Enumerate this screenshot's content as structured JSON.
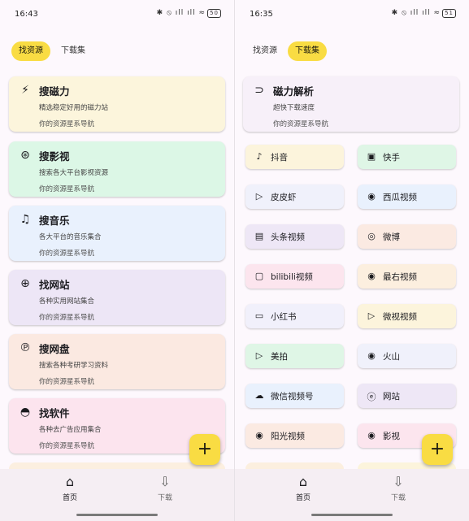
{
  "left_screen": {
    "status": {
      "time": "16:43",
      "icons": "✱ ⦸ ıll ıll ≈",
      "battery": "50"
    },
    "tabs": [
      {
        "label": "找资源",
        "active": true
      },
      {
        "label": "下载集",
        "active": false
      }
    ],
    "cards": [
      {
        "icon": "bolt-icon",
        "glyph": "⚡",
        "title": "搜磁力",
        "desc": "精选稳定好用的磁力站",
        "footer": "你的资源星系导航",
        "color": "#fcf5dc"
      },
      {
        "icon": "film-reel-icon",
        "glyph": "⊛",
        "title": "搜影视",
        "desc": "搜索各大平台影视资源",
        "footer": "你的资源星系导航",
        "color": "#dcf7e6"
      },
      {
        "icon": "music-note-icon",
        "glyph": "♫",
        "title": "搜音乐",
        "desc": "各大平台的音乐集合",
        "footer": "你的资源星系导航",
        "color": "#e9f1fd"
      },
      {
        "icon": "globe-icon",
        "glyph": "⊕",
        "title": "找网站",
        "desc": "各种实用网站集合",
        "footer": "你的资源星系导航",
        "color": "#ede6f6"
      },
      {
        "icon": "pinterest-icon",
        "glyph": "℗",
        "title": "搜网盘",
        "desc": "搜索各种考研学习资料",
        "footer": "你的资源星系导航",
        "color": "#fbe9e1"
      },
      {
        "icon": "android-icon",
        "glyph": "◓",
        "title": "找软件",
        "desc": "各种去广告应用集合",
        "footer": "你的资源星系导航",
        "color": "#fce4ee"
      }
    ],
    "fab_label": "+",
    "nav": [
      {
        "icon": "home-icon",
        "glyph": "⌂",
        "label": "首页",
        "active": true
      },
      {
        "icon": "download-icon",
        "glyph": "⇩",
        "label": "下载",
        "active": false
      }
    ]
  },
  "right_screen": {
    "status": {
      "time": "16:35",
      "icons": "✱ ⦸ ıll ıll ≈",
      "battery": "51"
    },
    "tabs": [
      {
        "label": "找资源",
        "active": false
      },
      {
        "label": "下载集",
        "active": true
      }
    ],
    "magnet_card": {
      "icon": "magnet-icon",
      "glyph": "⊃",
      "title": "磁力解析",
      "desc": "超快下载速度",
      "footer": "你的资源星系导航",
      "color": "#f7f0f9"
    },
    "grid": [
      {
        "icon": "tiktok-icon",
        "glyph": "♪",
        "label": "抖音",
        "color": "#fcf4dc"
      },
      {
        "icon": "kuaishou-icon",
        "glyph": "▣",
        "label": "快手",
        "color": "#dff6e6"
      },
      {
        "icon": "video-play-icon",
        "glyph": "▷",
        "label": "皮皮虾",
        "color": "#f0f1fb"
      },
      {
        "icon": "play-circle-icon",
        "glyph": "◉",
        "label": "西瓜视频",
        "color": "#e9f1fd"
      },
      {
        "icon": "news-icon",
        "glyph": "▤",
        "label": "头条视频",
        "color": "#eee7f6"
      },
      {
        "icon": "weibo-icon",
        "glyph": "◎",
        "label": "微博",
        "color": "#fbeae2"
      },
      {
        "icon": "bilibili-icon",
        "glyph": "▢",
        "label": "bilibili视频",
        "color": "#fce5ee"
      },
      {
        "icon": "play-circle-icon",
        "glyph": "◉",
        "label": "最右视频",
        "color": "#fcefdf"
      },
      {
        "icon": "video-box-icon",
        "glyph": "▭",
        "label": "小红书",
        "color": "#f1f0fb"
      },
      {
        "icon": "video-play-icon",
        "glyph": "▷",
        "label": "微视视频",
        "color": "#fcf4dc"
      },
      {
        "icon": "video-play-icon",
        "glyph": "▷",
        "label": "美拍",
        "color": "#dff6e6"
      },
      {
        "icon": "play-circle-icon",
        "glyph": "◉",
        "label": "火山",
        "color": "#f0f1fb"
      },
      {
        "icon": "cloud-icon",
        "glyph": "☁",
        "label": "微信视频号",
        "color": "#e9f1fd"
      },
      {
        "icon": "edge-icon",
        "glyph": "ⓔ",
        "label": "网站",
        "color": "#eee7f6"
      },
      {
        "icon": "play-circle-icon",
        "glyph": "◉",
        "label": "阳光视频",
        "color": "#fbeae2"
      },
      {
        "icon": "play-circle-icon",
        "glyph": "◉",
        "label": "影视",
        "color": "#fce5ee"
      }
    ],
    "fab_label": "+",
    "nav": [
      {
        "icon": "home-icon",
        "glyph": "⌂",
        "label": "首页",
        "active": true
      },
      {
        "icon": "download-icon",
        "glyph": "⇩",
        "label": "下载",
        "active": false
      }
    ]
  },
  "accent_color": "#f9dc43"
}
